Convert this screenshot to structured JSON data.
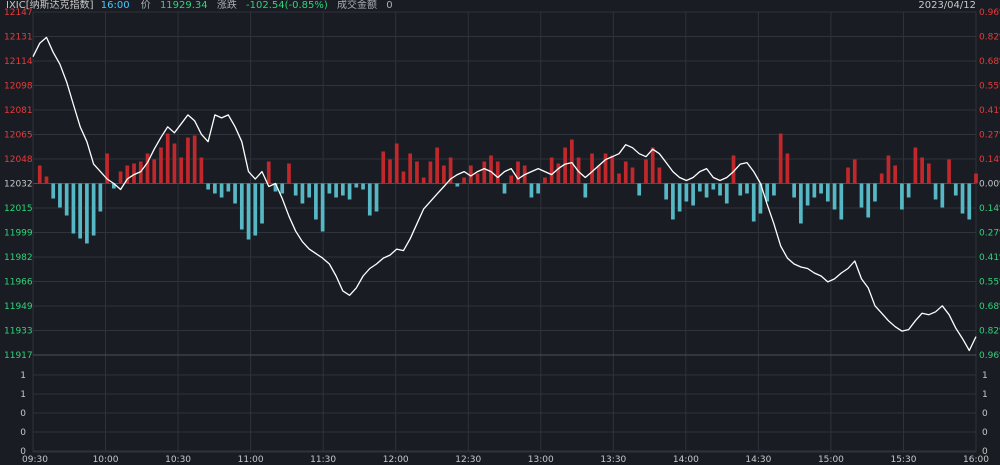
{
  "header": {
    "symbol": "IXIC[纳斯达克指数]",
    "time": "16:00",
    "price_label": "价",
    "price": "11929.34",
    "change_label": "涨跌",
    "change": "-102.54(-0.85%)",
    "volume_label": "成交金额",
    "volume": "0",
    "date": "2023/04/12"
  },
  "colors": {
    "background": "#191c22",
    "price_line": "#ffffff",
    "up": "#c0282c",
    "down": "#56b8c4",
    "up_text": "#e83b3b",
    "down_text": "#2ed47a",
    "grid": "#2f333b"
  },
  "chart_data": {
    "type": "line",
    "base_price": 12032,
    "left_axis_ticks": [
      "12147",
      "12131",
      "12114",
      "12098",
      "12081",
      "12065",
      "12048",
      "12032",
      "12015",
      "11999",
      "11982",
      "11966",
      "11949",
      "11933",
      "11917"
    ],
    "right_axis_ticks": [
      "0.96%",
      "0.82%",
      "0.68%",
      "0.55%",
      "0.41%",
      "0.27%",
      "0.14%",
      "0.00%",
      "0.14%",
      "0.27%",
      "0.41%",
      "0.55%",
      "0.68%",
      "0.82%",
      "0.96%"
    ],
    "x_ticks": [
      "09:30",
      "10:00",
      "10:30",
      "11:00",
      "11:30",
      "12:00",
      "12:30",
      "13:00",
      "13:30",
      "14:00",
      "14:30",
      "15:00",
      "15:30",
      "16:00"
    ],
    "volume_axis_ticks": [
      "1",
      "1",
      "0",
      "0",
      "0"
    ],
    "ylim": [
      11917,
      12147
    ],
    "price_series": [
      [
        0,
        12117
      ],
      [
        1,
        12126
      ],
      [
        2,
        12130
      ],
      [
        3,
        12120
      ],
      [
        4,
        12112
      ],
      [
        5,
        12100
      ],
      [
        6,
        12085
      ],
      [
        7,
        12070
      ],
      [
        8,
        12060
      ],
      [
        9,
        12045
      ],
      [
        10,
        12040
      ],
      [
        11,
        12035
      ],
      [
        12,
        12032
      ],
      [
        13,
        12028
      ],
      [
        14,
        12035
      ],
      [
        15,
        12038
      ],
      [
        16,
        12040
      ],
      [
        17,
        12046
      ],
      [
        18,
        12055
      ],
      [
        19,
        12063
      ],
      [
        20,
        12070
      ],
      [
        21,
        12066
      ],
      [
        22,
        12072
      ],
      [
        23,
        12078
      ],
      [
        24,
        12074
      ],
      [
        25,
        12065
      ],
      [
        26,
        12060
      ],
      [
        27,
        12078
      ],
      [
        28,
        12076
      ],
      [
        29,
        12078
      ],
      [
        30,
        12070
      ],
      [
        31,
        12060
      ],
      [
        32,
        12040
      ],
      [
        33,
        12035
      ],
      [
        34,
        12040
      ],
      [
        35,
        12030
      ],
      [
        36,
        12032
      ],
      [
        37,
        12022
      ],
      [
        38,
        12010
      ],
      [
        39,
        12000
      ],
      [
        40,
        11993
      ],
      [
        41,
        11988
      ],
      [
        42,
        11985
      ],
      [
        43,
        11982
      ],
      [
        44,
        11978
      ],
      [
        45,
        11970
      ],
      [
        46,
        11960
      ],
      [
        47,
        11957
      ],
      [
        48,
        11962
      ],
      [
        49,
        11970
      ],
      [
        50,
        11975
      ],
      [
        51,
        11978
      ],
      [
        52,
        11982
      ],
      [
        53,
        11984
      ],
      [
        54,
        11988
      ],
      [
        55,
        11987
      ],
      [
        56,
        11995
      ],
      [
        57,
        12005
      ],
      [
        58,
        12015
      ],
      [
        59,
        12020
      ],
      [
        60,
        12025
      ],
      [
        61,
        12030
      ],
      [
        62,
        12035
      ],
      [
        63,
        12038
      ],
      [
        64,
        12040
      ],
      [
        65,
        12037
      ],
      [
        66,
        12040
      ],
      [
        67,
        12042
      ],
      [
        68,
        12040
      ],
      [
        69,
        12036
      ],
      [
        70,
        12040
      ],
      [
        71,
        12042
      ],
      [
        72,
        12035
      ],
      [
        73,
        12038
      ],
      [
        74,
        12040
      ],
      [
        75,
        12042
      ],
      [
        76,
        12040
      ],
      [
        77,
        12038
      ],
      [
        78,
        12042
      ],
      [
        79,
        12045
      ],
      [
        80,
        12046
      ],
      [
        81,
        12040
      ],
      [
        82,
        12036
      ],
      [
        83,
        12040
      ],
      [
        84,
        12044
      ],
      [
        85,
        12048
      ],
      [
        86,
        12050
      ],
      [
        87,
        12052
      ],
      [
        88,
        12058
      ],
      [
        89,
        12056
      ],
      [
        90,
        12052
      ],
      [
        91,
        12050
      ],
      [
        92,
        12055
      ],
      [
        93,
        12052
      ],
      [
        94,
        12046
      ],
      [
        95,
        12040
      ],
      [
        96,
        12036
      ],
      [
        97,
        12034
      ],
      [
        98,
        12036
      ],
      [
        99,
        12040
      ],
      [
        100,
        12042
      ],
      [
        101,
        12036
      ],
      [
        102,
        12034
      ],
      [
        103,
        12036
      ],
      [
        104,
        12040
      ],
      [
        105,
        12045
      ],
      [
        106,
        12046
      ],
      [
        107,
        12040
      ],
      [
        108,
        12032
      ],
      [
        109,
        12018
      ],
      [
        110,
        12005
      ],
      [
        111,
        11990
      ],
      [
        112,
        11982
      ],
      [
        113,
        11978
      ],
      [
        114,
        11976
      ],
      [
        115,
        11975
      ],
      [
        116,
        11972
      ],
      [
        117,
        11970
      ],
      [
        118,
        11966
      ],
      [
        119,
        11968
      ],
      [
        120,
        11972
      ],
      [
        121,
        11975
      ],
      [
        122,
        11980
      ],
      [
        123,
        11968
      ],
      [
        124,
        11962
      ],
      [
        125,
        11950
      ],
      [
        126,
        11945
      ],
      [
        127,
        11940
      ],
      [
        128,
        11936
      ],
      [
        129,
        11933
      ],
      [
        130,
        11934
      ],
      [
        131,
        11940
      ],
      [
        132,
        11945
      ],
      [
        133,
        11944
      ],
      [
        134,
        11946
      ],
      [
        135,
        11950
      ],
      [
        136,
        11944
      ],
      [
        137,
        11935
      ],
      [
        138,
        11928
      ],
      [
        139,
        11920
      ],
      [
        140,
        11929.34
      ]
    ],
    "volume_bars": [
      [
        0,
        0
      ],
      [
        1,
        18
      ],
      [
        2,
        7
      ],
      [
        3,
        -15
      ],
      [
        4,
        -24
      ],
      [
        5,
        -32
      ],
      [
        6,
        -50
      ],
      [
        7,
        -55
      ],
      [
        8,
        -60
      ],
      [
        9,
        -52
      ],
      [
        10,
        -28
      ],
      [
        11,
        30
      ],
      [
        12,
        -5
      ],
      [
        13,
        12
      ],
      [
        14,
        18
      ],
      [
        15,
        20
      ],
      [
        16,
        22
      ],
      [
        17,
        30
      ],
      [
        18,
        24
      ],
      [
        19,
        36
      ],
      [
        20,
        50
      ],
      [
        21,
        40
      ],
      [
        22,
        26
      ],
      [
        23,
        46
      ],
      [
        24,
        48
      ],
      [
        25,
        26
      ],
      [
        26,
        -6
      ],
      [
        27,
        -10
      ],
      [
        28,
        -14
      ],
      [
        29,
        -8
      ],
      [
        30,
        -20
      ],
      [
        31,
        -46
      ],
      [
        32,
        -56
      ],
      [
        33,
        -52
      ],
      [
        34,
        -40
      ],
      [
        35,
        22
      ],
      [
        36,
        -8
      ],
      [
        37,
        -10
      ],
      [
        38,
        20
      ],
      [
        39,
        -12
      ],
      [
        40,
        -20
      ],
      [
        41,
        -14
      ],
      [
        42,
        -36
      ],
      [
        43,
        -48
      ],
      [
        44,
        -10
      ],
      [
        45,
        -14
      ],
      [
        46,
        -12
      ],
      [
        47,
        -16
      ],
      [
        48,
        -4
      ],
      [
        49,
        -6
      ],
      [
        50,
        -32
      ],
      [
        51,
        -28
      ],
      [
        52,
        32
      ],
      [
        53,
        24
      ],
      [
        54,
        40
      ],
      [
        55,
        12
      ],
      [
        56,
        30
      ],
      [
        57,
        22
      ],
      [
        58,
        6
      ],
      [
        59,
        22
      ],
      [
        60,
        36
      ],
      [
        61,
        18
      ],
      [
        62,
        26
      ],
      [
        63,
        -3
      ],
      [
        64,
        6
      ],
      [
        65,
        18
      ],
      [
        66,
        10
      ],
      [
        67,
        22
      ],
      [
        68,
        28
      ],
      [
        69,
        22
      ],
      [
        70,
        -10
      ],
      [
        71,
        8
      ],
      [
        72,
        22
      ],
      [
        73,
        18
      ],
      [
        74,
        -14
      ],
      [
        75,
        -10
      ],
      [
        76,
        6
      ],
      [
        77,
        26
      ],
      [
        78,
        20
      ],
      [
        79,
        36
      ],
      [
        80,
        44
      ],
      [
        81,
        26
      ],
      [
        82,
        -14
      ],
      [
        83,
        30
      ],
      [
        84,
        18
      ],
      [
        85,
        30
      ],
      [
        86,
        28
      ],
      [
        87,
        10
      ],
      [
        88,
        22
      ],
      [
        89,
        16
      ],
      [
        90,
        -12
      ],
      [
        91,
        24
      ],
      [
        92,
        36
      ],
      [
        93,
        16
      ],
      [
        94,
        -16
      ],
      [
        95,
        -36
      ],
      [
        96,
        -28
      ],
      [
        97,
        -18
      ],
      [
        98,
        -22
      ],
      [
        99,
        -8
      ],
      [
        100,
        -14
      ],
      [
        101,
        -6
      ],
      [
        102,
        -12
      ],
      [
        103,
        -20
      ],
      [
        104,
        28
      ],
      [
        105,
        -12
      ],
      [
        106,
        -10
      ],
      [
        107,
        -38
      ],
      [
        108,
        -30
      ],
      [
        109,
        -18
      ],
      [
        110,
        -12
      ],
      [
        111,
        50
      ],
      [
        112,
        30
      ],
      [
        113,
        -14
      ],
      [
        114,
        -40
      ],
      [
        115,
        -22
      ],
      [
        116,
        -14
      ],
      [
        117,
        -10
      ],
      [
        118,
        -18
      ],
      [
        119,
        -26
      ],
      [
        120,
        -36
      ],
      [
        121,
        16
      ],
      [
        122,
        24
      ],
      [
        123,
        -24
      ],
      [
        124,
        -34
      ],
      [
        125,
        -18
      ],
      [
        126,
        10
      ],
      [
        127,
        28
      ],
      [
        128,
        18
      ],
      [
        129,
        -26
      ],
      [
        130,
        -14
      ],
      [
        131,
        36
      ],
      [
        132,
        26
      ],
      [
        133,
        20
      ],
      [
        134,
        -16
      ],
      [
        135,
        -24
      ],
      [
        136,
        24
      ],
      [
        137,
        -12
      ],
      [
        138,
        -30
      ],
      [
        139,
        -36
      ],
      [
        140,
        10
      ]
    ],
    "total_points": 140
  }
}
